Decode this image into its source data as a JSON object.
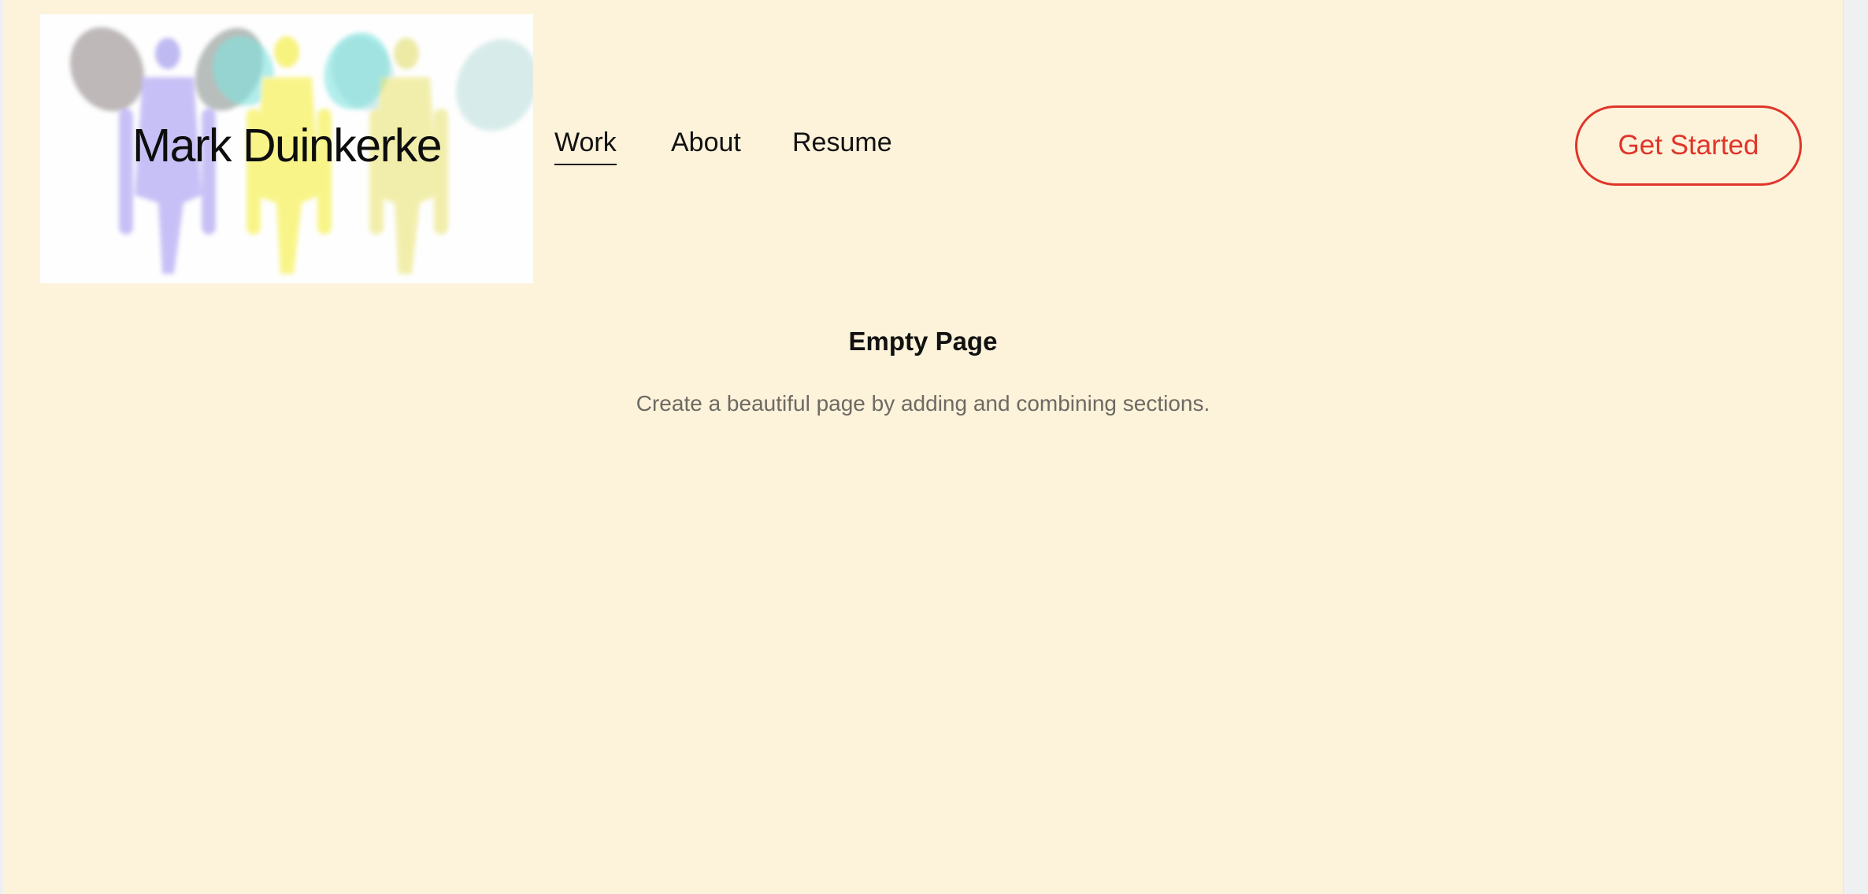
{
  "site": {
    "logo_text": "Mark Duinkerke"
  },
  "nav": {
    "items": [
      {
        "label": "Work",
        "active": true
      },
      {
        "label": "About",
        "active": false
      },
      {
        "label": "Resume",
        "active": false
      }
    ]
  },
  "header": {
    "cta_label": "Get Started"
  },
  "main": {
    "title": "Empty Page",
    "subtitle": "Create a beautiful page by adding and combining sections."
  },
  "colors": {
    "page_background": "#fdf2da",
    "accent": "#e0352a",
    "text": "#111111",
    "muted_text": "#6d6a63"
  }
}
